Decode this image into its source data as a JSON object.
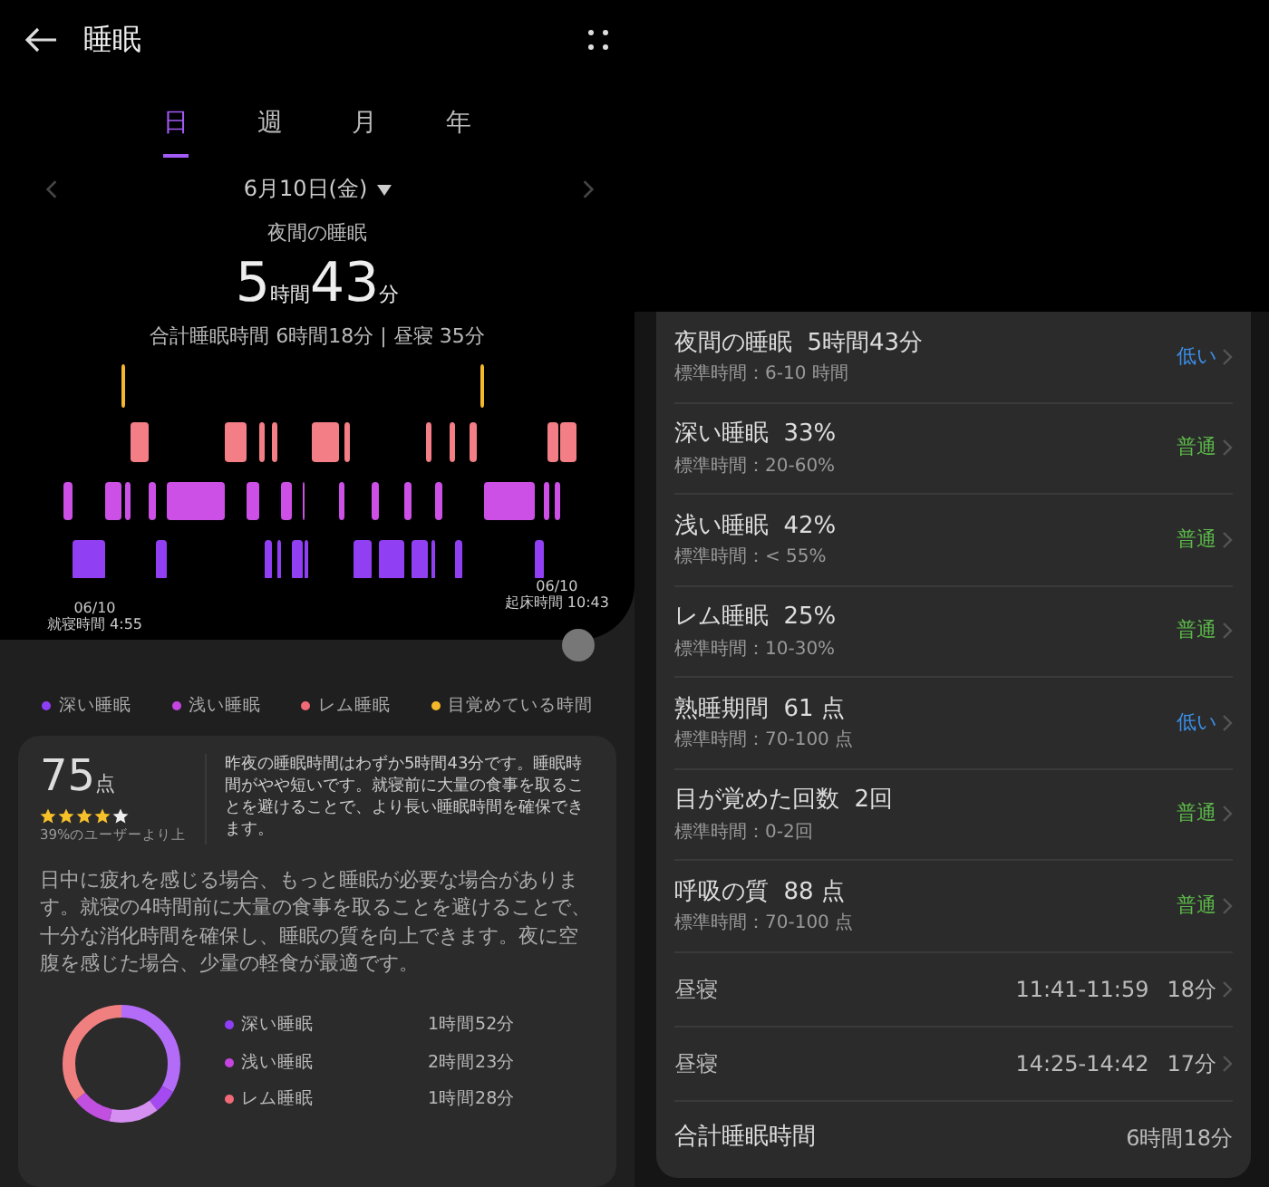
{
  "header": {
    "title": "睡眠"
  },
  "tabs": [
    {
      "label": "日",
      "selected": true
    },
    {
      "label": "週",
      "selected": false
    },
    {
      "label": "月",
      "selected": false
    },
    {
      "label": "年",
      "selected": false
    }
  ],
  "date": "6月10日(金)",
  "night_sleep": {
    "label": "夜間の睡眠",
    "hours": "5",
    "hours_unit": "時間",
    "minutes": "43",
    "minutes_unit": "分"
  },
  "summary": "合計睡眠時間 6時間18分 | 昼寝 35分",
  "chart_labels": {
    "start_date": "06/10",
    "start_time": "就寝時間 4:55",
    "end_date": "06/10",
    "end_time": "起床時間 10:43"
  },
  "legend": [
    {
      "label": "深い睡眠",
      "color": "#8e3ff5"
    },
    {
      "label": "浅い睡眠",
      "color": "#c645e0"
    },
    {
      "label": "レム睡眠",
      "color": "#f06a78"
    },
    {
      "label": "目覚めている時間",
      "color": "#f5b82a"
    }
  ],
  "score": {
    "value": "75",
    "unit": "点",
    "stars": 4,
    "rank": "39%のユーザーより上",
    "comment": "昨夜の睡眠時間はわずか5時間43分です。睡眠時間がやや短いです。就寝前に大量の食事を取ることを避けることで、より長い睡眠時間を確保できます。"
  },
  "advice": "日中に疲れを感じる場合、もっと睡眠が必要な場合があります。就寝の4時間前に大量の食事を取ることを避けることで、十分な消化時間を確保し、睡眠の質を向上できます。夜に空腹を感じた場合、少量の軽食が最適です。",
  "breakdown": [
    {
      "label": "深い睡眠",
      "value": "1時間52分",
      "color": "#8e3ff5"
    },
    {
      "label": "浅い睡眠",
      "value": "2時間23分",
      "color": "#c645e0"
    },
    {
      "label": "レム睡眠",
      "value": "1時間28分",
      "color": "#f06a78"
    }
  ],
  "metrics": [
    {
      "kind": "rated",
      "title": "夜間の睡眠  5時間43分",
      "standard": "標準時間：6-10 時間",
      "rating": "低い",
      "color": "#3b8fe8"
    },
    {
      "kind": "rated",
      "title": "深い睡眠  33%",
      "standard": "標準時間：20-60%",
      "rating": "普通",
      "color": "#5cb84a"
    },
    {
      "kind": "rated",
      "title": "浅い睡眠  42%",
      "standard": "標準時間：< 55%",
      "rating": "普通",
      "color": "#5cb84a"
    },
    {
      "kind": "rated",
      "title": "レム睡眠  25%",
      "standard": "標準時間：10-30%",
      "rating": "普通",
      "color": "#5cb84a"
    },
    {
      "kind": "rated",
      "title": "熟睡期間  61 点",
      "standard": "標準時間：70-100 点",
      "rating": "低い",
      "color": "#3b8fe8"
    },
    {
      "kind": "rated",
      "title": "目が覚めた回数  2回",
      "standard": "標準時間：0-2回",
      "rating": "普通",
      "color": "#5cb84a"
    },
    {
      "kind": "rated",
      "title": "呼吸の質  88 点",
      "standard": "標準時間：70-100 点",
      "rating": "普通",
      "color": "#5cb84a"
    },
    {
      "kind": "nap",
      "title": "昼寝",
      "time": "11:41-11:59",
      "duration": "18分"
    },
    {
      "kind": "nap",
      "title": "昼寝",
      "time": "14:25-14:42",
      "duration": "17分"
    },
    {
      "kind": "total",
      "title": "合計睡眠時間",
      "duration": "6時間18分"
    }
  ]
}
